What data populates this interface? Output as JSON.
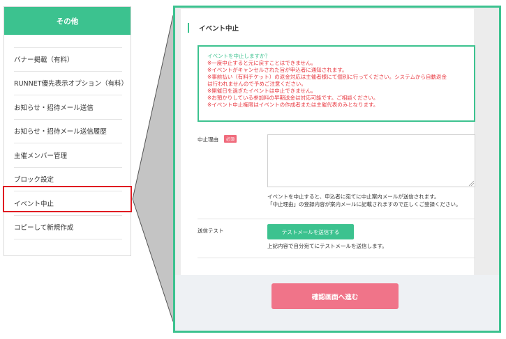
{
  "sidebar": {
    "header": "その他",
    "items": [
      {
        "label": "バナー掲載（有料）"
      },
      {
        "label": "RUNNET優先表示オプション（有料）"
      },
      {
        "label": "お知らせ・招待メール送信"
      },
      {
        "label": "お知らせ・招待メール送信履歴"
      },
      {
        "label": "主催メンバー管理"
      },
      {
        "label": "ブロック設定"
      },
      {
        "label": "イベント中止"
      },
      {
        "label": "コピーして新規作成"
      }
    ]
  },
  "panel": {
    "title": "イベント中止",
    "warning": {
      "title": "イベントを中止しますか？",
      "lines": [
        "※一度中止すると元に戻すことはできません。",
        "※イベントがキャンセルされた旨が申込者に通知されます。",
        "※事前払い（有料チケット）の返金対応は主催者様にて個別に行ってください。システムから自動返金",
        "は行われませんので予めご注意ください。",
        "※開催日を過ぎたイベントは中止できません。",
        "※お預かりしている参加料の早期送金は対応可能です。ご相談ください。",
        "※イベント中止権限はイベントの作成者または主催代表のみとなります。"
      ]
    },
    "reason": {
      "label": "中止理由",
      "required": "必須",
      "value": "",
      "note_1": "イベントを中止すると、申込者に宛てに中止案内メールが送信されます。",
      "note_2": "「中止理由」の登録内容が案内メールに記載されますので正しくご登録ください。"
    },
    "test": {
      "label": "送信テスト",
      "button": "テストメールを送信する",
      "note": "上記内容で自分宛てにテストメールを送信します。"
    },
    "confirm_button": "確認画面へ進む"
  },
  "colors": {
    "accent": "#3cc28f",
    "warning_text": "#e8373f",
    "confirm_button": "#f07489",
    "highlight": "#e01b22"
  }
}
